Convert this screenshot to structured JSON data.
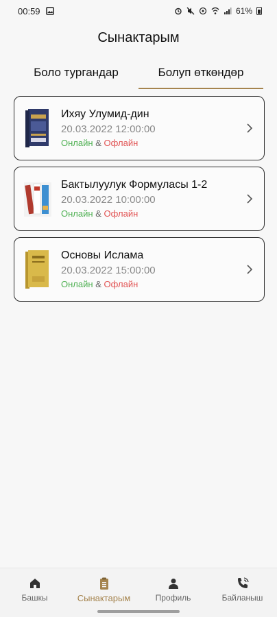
{
  "status_bar": {
    "time": "00:59",
    "battery": "61%",
    "icons": [
      "gallery-icon",
      "alarm-icon",
      "mute-icon",
      "hotspot-icon",
      "wifi-icon",
      "signal-icon",
      "battery-icon"
    ]
  },
  "header": {
    "title": "Сынактарым"
  },
  "tabs": [
    {
      "label": "Боло тургандар",
      "active": false
    },
    {
      "label": "Болуп өткөндөр",
      "active": true
    }
  ],
  "tests": [
    {
      "title": "Ихяу Улумид-дин",
      "date": "20.03.2022 12:00:00",
      "online": "Онлайн",
      "amp": "&",
      "offline": "Офлайн",
      "thumb": "book-cover-1"
    },
    {
      "title": "Бактылуулук Формуласы 1-2",
      "date": "20.03.2022 10:00:00",
      "online": "Онлайн",
      "amp": "&",
      "offline": "Офлайн",
      "thumb": "book-cover-2"
    },
    {
      "title": "Основы Ислама",
      "date": "20.03.2022 15:00:00",
      "online": "Онлайн",
      "amp": "&",
      "offline": "Офлайн",
      "thumb": "book-cover-3"
    }
  ],
  "bottom_nav": [
    {
      "label": "Башкы",
      "icon": "home-icon",
      "active": false
    },
    {
      "label": "Сынактарым",
      "icon": "clipboard-icon",
      "active": true
    },
    {
      "label": "Профиль",
      "icon": "person-icon",
      "active": false
    },
    {
      "label": "Байланыш",
      "icon": "phone-icon",
      "active": false
    }
  ],
  "colors": {
    "accent": "#a5844e",
    "online": "#4caf50",
    "offline": "#e15252"
  }
}
